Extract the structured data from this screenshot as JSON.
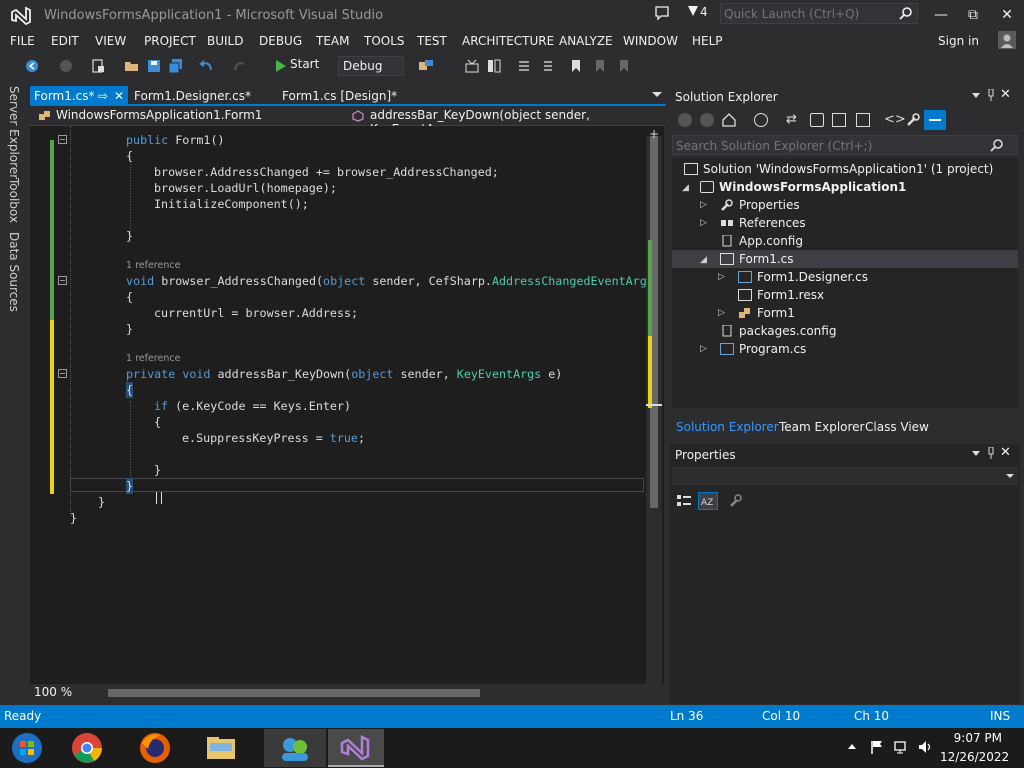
{
  "window": {
    "title": "WindowsFormsApplication1 - Microsoft Visual Studio",
    "notification_count": "4",
    "quick_launch_placeholder": "Quick Launch (Ctrl+Q)",
    "minimize": "—",
    "restore": "⧉",
    "close": "✕"
  },
  "menu": [
    "FILE",
    "EDIT",
    "VIEW",
    "PROJECT",
    "BUILD",
    "DEBUG",
    "TEAM",
    "TOOLS",
    "TEST",
    "ARCHITECTURE",
    "ANALYZE",
    "WINDOW",
    "HELP"
  ],
  "signin": "Sign in",
  "toolbar": {
    "start_label": "Start",
    "configuration": "Debug"
  },
  "left_strip": [
    "Server Explorer",
    "Toolbox",
    "Data Sources"
  ],
  "editor_tabs": [
    {
      "label": "Form1.cs*",
      "pin": "⇨",
      "close": "✕"
    },
    {
      "label": "Form1.Designer.cs*"
    },
    {
      "label": "Form1.cs [Design]*"
    }
  ],
  "navbar": {
    "class": "WindowsFormsApplication1.Form1",
    "member": "addressBar_KeyDown(object sender, KeyEventArgs e"
  },
  "code": {
    "l1": [
      "public",
      " Form1()"
    ],
    "l2": "{",
    "l3": "browser.AddressChanged += browser_AddressChanged;",
    "l4": "browser.LoadUrl(homepage);",
    "l5": "InitializeComponent();",
    "l6": "}",
    "ref1": "1 reference",
    "l7": [
      "void",
      " browser_AddressChanged(",
      "object",
      " sender, CefSharp.",
      "AddressChangedEventArgs"
    ],
    "l8": "{",
    "l9": "currentUrl = browser.Address;",
    "l10": "}",
    "ref2": "1 reference",
    "l11": [
      "private",
      " ",
      "void",
      " addressBar_KeyDown(",
      "object",
      " sender, ",
      "KeyEventArgs",
      " e)"
    ],
    "l12": "{",
    "l13": [
      "if",
      " (e.KeyCode == Keys.Enter)"
    ],
    "l14": "{",
    "l15": [
      "e.SuppressKeyPress = ",
      "true",
      ";"
    ],
    "l16": "}",
    "l17": "}",
    "l18": "}",
    "l19": "}"
  },
  "zoom": "100 %",
  "status": {
    "ready": "Ready",
    "ln": "Ln 36",
    "col": "Col 10",
    "ch": "Ch 10",
    "ins": "INS"
  },
  "solution_explorer": {
    "title": "Solution Explorer",
    "search_placeholder": "Search Solution Explorer (Ctrl+;)",
    "items": [
      "Solution 'WindowsFormsApplication1' (1 project)",
      "WindowsFormsApplication1",
      "Properties",
      "References",
      "App.config",
      "Form1.cs",
      "Form1.Designer.cs",
      "Form1.resx",
      "Form1",
      "packages.config",
      "Program.cs"
    ],
    "tabs": [
      "Solution Explorer",
      "Team Explorer",
      "Class View"
    ]
  },
  "properties": {
    "title": "Properties"
  },
  "clock": {
    "time": "9:07 PM",
    "date": "12/26/2022"
  },
  "colors": {
    "accent": "#007acc",
    "keyword": "#569cd6",
    "type": "#4ec9b0",
    "changed_saved": "#57a64a",
    "changed_unsaved": "#e8d314"
  }
}
